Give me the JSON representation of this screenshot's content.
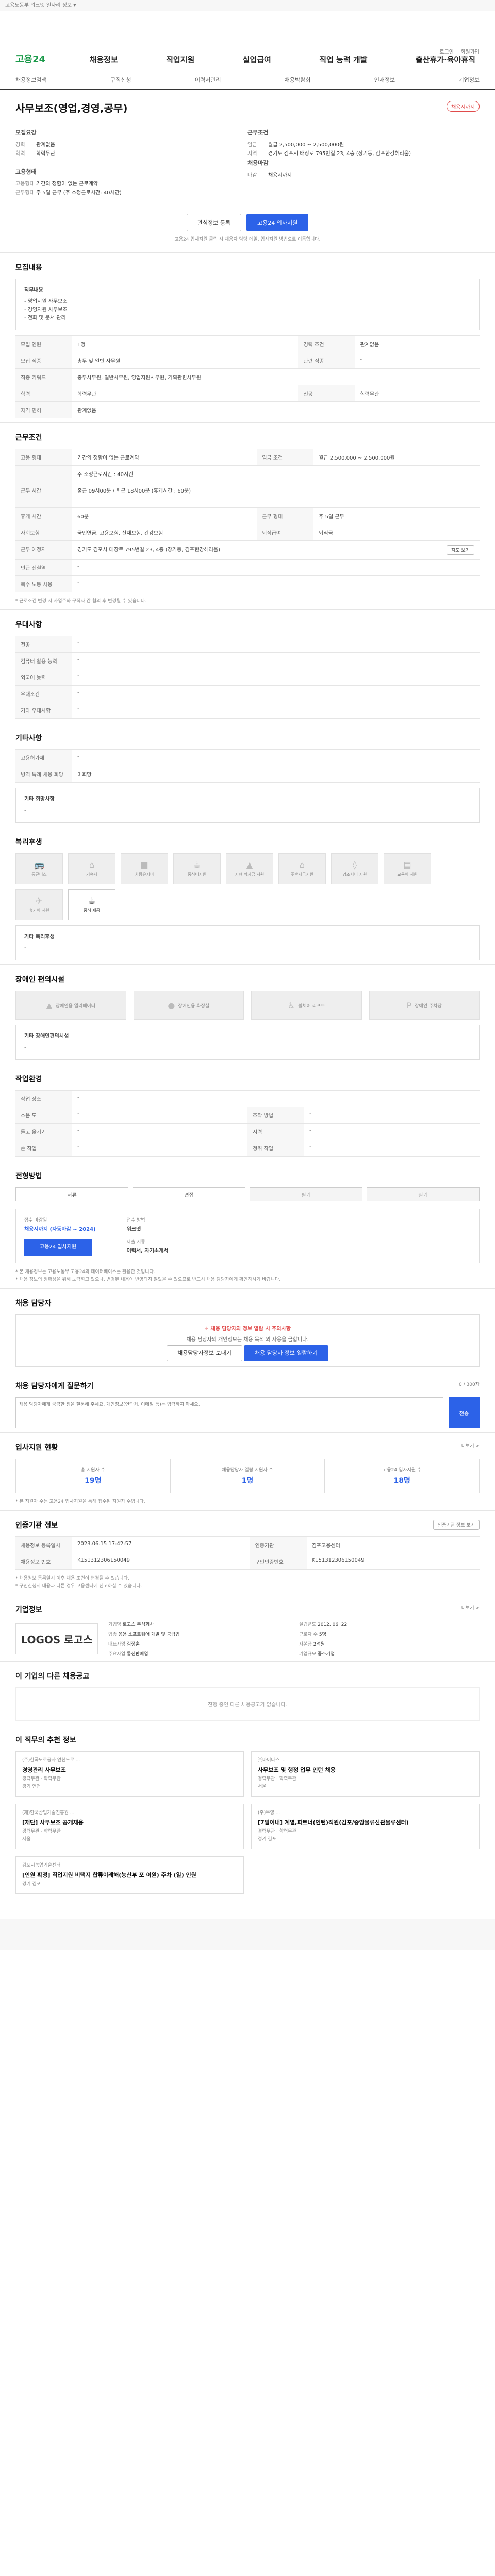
{
  "topbar": {
    "text": "고용노동부 워크넷 일자리 정보 ▾"
  },
  "util": [
    "로그인",
    "회원가입"
  ],
  "gnb": {
    "logo": "고용24",
    "items": [
      "채용정보",
      "직업지원",
      "실업급여",
      "직업 능력 개발",
      "출산휴가·육아휴직"
    ]
  },
  "lnb": [
    "채용정보검색",
    "구직신청",
    "이력서관리",
    "채용박람회",
    "인재정보",
    "기업정보"
  ],
  "job": {
    "title": "사무보조(영업,경영,공무)",
    "tag": "채용시까지"
  },
  "summary": {
    "recruit_label": "모집요강",
    "recruit_rows": [
      {
        "k": "경력",
        "v": "관계없음"
      },
      {
        "k": "학력",
        "v": "학력무관"
      }
    ],
    "cond_label": "근무조건",
    "cond_rows": [
      {
        "k": "임금",
        "v": "월급 2,500,000 ~ 2,500,000원"
      },
      {
        "k": "지역",
        "v": "경기도 김포시 태장로 795번길 23, 4층 (장기동, 김포한강헤리움)"
      }
    ],
    "employ_label": "고용형태",
    "employ_rows": [
      {
        "k": "고용형태",
        "v": "기간의 정함이 없는 근로계약"
      },
      {
        "k": "근무형태",
        "v": "주 5일 근무 (주 소정근로시간: 40시간)"
      }
    ],
    "deadline_label": "채용마감",
    "deadline_rows": [
      {
        "k": "마감",
        "v": "채용시까지"
      }
    ]
  },
  "buttons": {
    "scrap": "관심정보 등록",
    "apply": "고용24 입사지원"
  },
  "notice": "고용24 입사지원 클릭 시 채용자 담당 메일, 입사지원 방법으로 이동합니다.",
  "sections": {
    "job_desc": {
      "title": "모집내용",
      "box_title": "직무내용",
      "box_lines": [
        "- 영업지원 사무보조",
        "- 경영지원 사무보조",
        "- 전화 및 문서 관리"
      ],
      "rows": [
        {
          "h": "모집 인원",
          "v": "1명",
          "h2": "경력 조건",
          "v2": "관계없음"
        },
        {
          "h": "모집 직종",
          "v": "총무 및 일반 사무원",
          "h2": "관련 직종",
          "v2": "-"
        },
        {
          "h": "직종 키워드",
          "v": "총무사무원, 일반사무원, 영업지원사무원, 기획관련사무원",
          "h2": "",
          "v2": ""
        },
        {
          "h": "학력",
          "v": "학력무관",
          "h2": "전공",
          "v2": "학력무관"
        },
        {
          "h": "자격 면허",
          "v": "관계없음",
          "h2": "",
          "v2": ""
        }
      ]
    },
    "conditions": {
      "title": "근무조건",
      "rows": [
        {
          "h": "고용 형태",
          "v": "기간의 정함이 없는 근로계약",
          "h2": "임금 조건",
          "v2": "월급 2,500,000 ~ 2,500,000원"
        },
        {
          "h": "",
          "v": "주 소정근로시간 : 40시간",
          "h2": "",
          "v2": ""
        },
        {
          "h": "근무 시간",
          "v": "출근 09시00분 / 퇴근 18시00분 (휴게시간 : 60분)",
          "h2": "",
          "v2": ""
        },
        {
          "h": "휴게 시간",
          "v": "60분",
          "h2": "근무 형태",
          "v2": "주 5일 근무"
        },
        {
          "h": "사회보험",
          "v": "국민연금, 고용보험, 산재보험, 건강보험",
          "h2": "퇴직급여",
          "v2": "퇴직금"
        },
        {
          "h": "근무 예정지",
          "v": "경기도 김포시 태장로 795번길 23, 4층 (장기동, 김포한강헤리움)",
          "h2": "",
          "v2": ""
        },
        {
          "h": "인근 전철역",
          "v": "-",
          "h2": "",
          "v2": ""
        },
        {
          "h": "복수 노동 사용",
          "v": "-",
          "h2": "",
          "v2": ""
        }
      ],
      "map_btn": "지도 보기",
      "footnote": "* 근로조건 변경 시 사업주와 구직자 간 협의 후 변경될 수 있습니다."
    },
    "prefs": {
      "title": "우대사항",
      "rows": [
        {
          "h": "전공",
          "v": "-"
        },
        {
          "h": "컴퓨터 활용 능력",
          "v": "-"
        },
        {
          "h": "외국어 능력",
          "v": "-"
        },
        {
          "h": "우대조건",
          "v": "-"
        },
        {
          "h": "기타 우대사항",
          "v": "-"
        }
      ]
    },
    "etc": {
      "title": "기타사항",
      "rows": [
        {
          "h": "고용허가제",
          "v": "-"
        },
        {
          "h": "병역 특례 채용 희망",
          "v": "미희망"
        }
      ],
      "box_title": "기타 희망사항",
      "box_value": "-"
    },
    "welfare": {
      "title": "복리후생",
      "items": [
        "통근버스",
        "기숙사",
        "차량유지비",
        "중식비지원",
        "자녀 학자금 지원",
        "주택자금지원",
        "경조사비 지원",
        "교육비 지원",
        "휴가비 지원",
        "중식 제공"
      ],
      "box_title": "기타 복리후생",
      "box_value": "-"
    },
    "disability": {
      "title": "장애인 편의시설",
      "items": [
        "장애인용 엘리베이터",
        "장애인용 화장실",
        "휠체어 리프트",
        "장애인 주차장"
      ],
      "box_title": "기타 장애인편의시설",
      "box_value": "-"
    },
    "work_env": {
      "title": "작업환경",
      "rows": [
        {
          "h": "작업 장소",
          "v": "-",
          "h2": "",
          "v2": ""
        },
        {
          "h": "소음 도",
          "v": "-",
          "h2": "조작 방법",
          "v2": "-"
        },
        {
          "h": "들고 옮기기",
          "v": "-",
          "h2": "시력",
          "v2": "-"
        },
        {
          "h": "손 작업",
          "v": "-",
          "h2": "청취 작업",
          "v2": "-"
        }
      ]
    },
    "process": {
      "title": "전형방법",
      "steps": [
        "서류",
        "면접",
        "필기",
        "실기"
      ],
      "method_k1": "접수 마감일",
      "method_v1": "채용시까지 (자동마감 ~ 2024)",
      "method_k2": "접수 방법",
      "method_v2": "워크넷",
      "method_k3": "제출 서류",
      "method_v3": "이력서, 자기소개서",
      "apply_btn": "고용24 입사지원",
      "notes": [
        "* 본 채용정보는 고용노동부 고용24의 데이터베이스를 활용한 것입니다.",
        "* 채용 정보의 정확성을 위해 노력하고 있으나, 변경된 내용이 반영되지 않았을 수 있으므로 반드시 채용 담당자에게 확인하시기 바랍니다."
      ]
    },
    "contact": {
      "title": "채용 담당자",
      "warn": "채용 담당자의 정보 열람 시 주의사항",
      "desc": "채용 담당자의 개인정보는 채용 목적 외 사용을 금합니다.",
      "btn1": "채용담당자정보 보내기",
      "btn2": "채용 담당자 정보 열람하기"
    },
    "qna": {
      "title": "채용 담당자에게 질문하기",
      "count": "0 / 300자",
      "placeholder": "채용 담당자에게 궁금한 점을 질문해 주세요. 개인정보(연락처, 이메일 등)는 입력하지 마세요.",
      "send": "전송"
    },
    "stats": {
      "title": "입사지원 현황",
      "more": "더보기 >",
      "items": [
        {
          "k": "총 지원자 수",
          "v": "19명"
        },
        {
          "k": "채용담당자 열람 지원자 수",
          "v": "1명"
        },
        {
          "k": "고용24 입사지원 수",
          "v": "18명"
        }
      ],
      "note": "* 본 지원자 수는 고용24 입사지원을 통해 접수된 지원자 수입니다."
    },
    "info": {
      "title": "인증기관 정보",
      "btn": "인증기관 정보 보기",
      "rows": [
        {
          "h": "채용정보 등록일시",
          "v": "2023.06.15 17:42:57",
          "h2": "인증기관",
          "v2": "김포고용센터"
        },
        {
          "h": "채용정보 번호",
          "v": "K151312306150049",
          "h2": "구인인증번호",
          "v2": "K151312306150049"
        }
      ],
      "notes": [
        "* 채용정보 등록일시 이후 채용 조건이 변경될 수 있습니다.",
        "* 구인신청서 내용과 다른 경우 고용센터에 신고하실 수 있습니다."
      ]
    },
    "company": {
      "title": "기업정보",
      "more": "더보기 >",
      "logo": "LOGOS 로고스",
      "rows": [
        {
          "k": "기업명",
          "v": "로고스 주식회사"
        },
        {
          "k": "설립년도",
          "v": "2012. 06. 22"
        },
        {
          "k": "업종",
          "v": "응용 소프트웨어 개발 및 공급업"
        },
        {
          "k": "근로자 수",
          "v": "5명"
        },
        {
          "k": "대표자명",
          "v": "김정훈"
        },
        {
          "k": "자본금",
          "v": "2억원"
        },
        {
          "k": "주요사업",
          "v": "통신판매업"
        },
        {
          "k": "기업규모",
          "v": "중소기업"
        }
      ]
    },
    "others": {
      "title": "이 기업의 다른 채용공고",
      "empty": "진행 중인 다른 채용공고가 없습니다."
    },
    "similar": {
      "title": "이 직무의 추천 정보",
      "cards": [
        {
          "company": "(주)한국도로공사 연천도로 ...",
          "title": "경영관리 사무보조",
          "meta": "경력무관 · 학력무관",
          "loc": "경기 연천"
        },
        {
          "company": "㈜마이다스 ...",
          "title": "사무보조 및 행정 업무 인턴 채용",
          "meta": "경력무관 · 학력무관",
          "loc": "서울"
        },
        {
          "company": "(재)한국산업기술진흥원 ...",
          "title": "[재단] 사무보조 공개채용",
          "meta": "경력무관 · 학력무관",
          "loc": "서울"
        },
        {
          "company": "(주)부영 ...",
          "title": "[7일이내] 계열,파트너(인턴)직원(김포/중앙물류신관물류센터)",
          "meta": "경력무관 · 학력무관",
          "loc": "경기 김포"
        },
        {
          "company": "김포시농업기술센터",
          "title": "[인원 확정] 직업지원 비택지 합류이래해(농산부 포 이원) 주차 (일) 인원",
          "meta": "",
          "loc": "경기 김포"
        }
      ]
    }
  }
}
